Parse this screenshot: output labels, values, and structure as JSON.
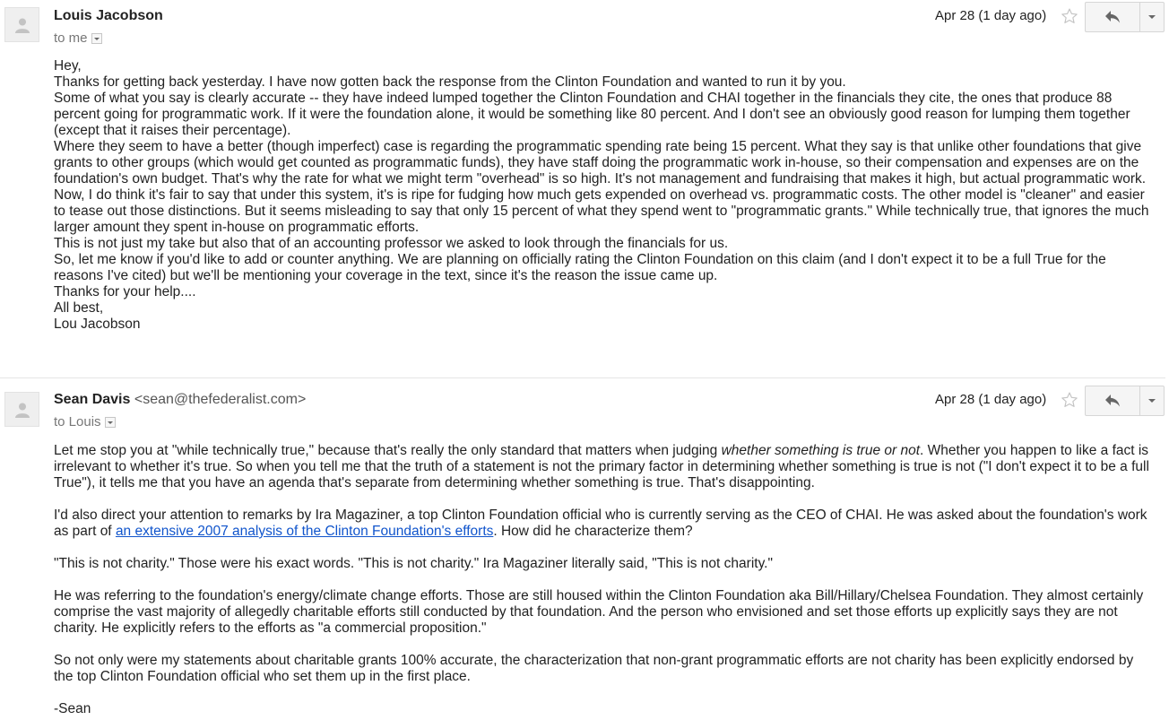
{
  "messages": [
    {
      "sender_name": "Louis Jacobson",
      "sender_email": "",
      "recipient": "to me",
      "date": "Apr 28 (1 day ago)",
      "body": [
        "Hey,",
        "Thanks for getting back yesterday. I have now gotten back the response from the Clinton Foundation and wanted to run it by you.",
        "Some of what you say is clearly accurate -- they have indeed lumped together the Clinton Foundation and CHAI together in the financials they cite, the ones that produce 88 percent going for programmatic work. If it were the foundation alone, it would be something like 80 percent. And I don't see an obviously good reason for lumping them together (except that it raises their percentage).",
        "Where they seem to have a better (though imperfect) case is regarding the programmatic spending rate being 15 percent. What they say is that unlike other foundations that give grants to other groups (which would get counted as programmatic funds), they have staff doing the programmatic work in-house, so their compensation and expenses are on the foundation's own budget. That's why the rate for what we might term \"overhead\" is so high. It's not management and fundraising that makes it high, but actual programmatic work.",
        "Now, I do think it's fair to say that under this system, it's is ripe for fudging how much gets expended on overhead vs. programmatic costs. The other model is \"cleaner\" and easier to tease out those distinctions. But it seems misleading to say that only 15 percent of what they spend went to \"programmatic grants.\" While technically true, that ignores the much larger amount they spent in-house on programmatic efforts.",
        "This is not just my take but also that of an accounting professor we asked to look through the financials for us.",
        "So, let me know if you'd like to add or counter anything. We are planning on officially rating the Clinton Foundation on this claim (and I don't expect it to be a full True for the reasons I've cited) but we'll be mentioning your coverage in the text, since it's the reason the issue came up.",
        "Thanks for your help....",
        "All best,",
        "Lou Jacobson"
      ]
    },
    {
      "sender_name": "Sean Davis",
      "sender_email": "<sean@thefederalist.com>",
      "recipient": "to Louis",
      "date": "Apr 28 (1 day ago)",
      "p1_a": "Let me stop you at \"while technically true,\" because that's really the only standard that matters when judging ",
      "p1_em": "whether something is true or not",
      "p1_b": ". Whether you happen to like a fact is irrelevant to whether it's true. So when you tell me that the truth of a statement is not the primary factor in determining whether something is true is not (\"I don't expect it to be a full True\"), it tells me that you have an agenda that's separate from determining whether something is true. That's disappointing.",
      "p2_a": "I'd also direct your attention to remarks by Ira Magaziner, a top Clinton Foundation official who is currently serving as the CEO of CHAI. He was asked about the foundation's work as part of ",
      "p2_link": "an extensive 2007 analysis of the Clinton Foundation's efforts",
      "p2_b": ". How did he characterize them?",
      "p3": "\"This is not charity.\" Those were his exact words. \"This is not charity.\" Ira Magaziner literally said, \"This is not charity.\"",
      "p4": "He was referring to the foundation's energy/climate change efforts. Those are still housed within the Clinton Foundation aka Bill/Hillary/Chelsea Foundation. They almost certainly comprise the vast majority of allegedly charitable efforts still conducted by that foundation. And the person who envisioned and set those efforts up explicitly says they are not charity. He explicitly refers to the efforts as \"a commercial proposition.\"",
      "p5": "So not only were my statements about charitable grants 100% accurate, the characterization that non-grant programmatic efforts are not charity has been explicitly endorsed by the top Clinton Foundation official who set them up in the first place.",
      "signoff": "-Sean"
    }
  ],
  "icons": {
    "avatar": "person-icon",
    "star": "star-outline-icon",
    "reply": "reply-arrow-icon",
    "more": "chevron-down-icon"
  },
  "colors": {
    "link": "#1155cc",
    "avatar_bg": "#efefef",
    "avatar_glyph": "#c3c3c3",
    "muted_text": "#777777"
  }
}
